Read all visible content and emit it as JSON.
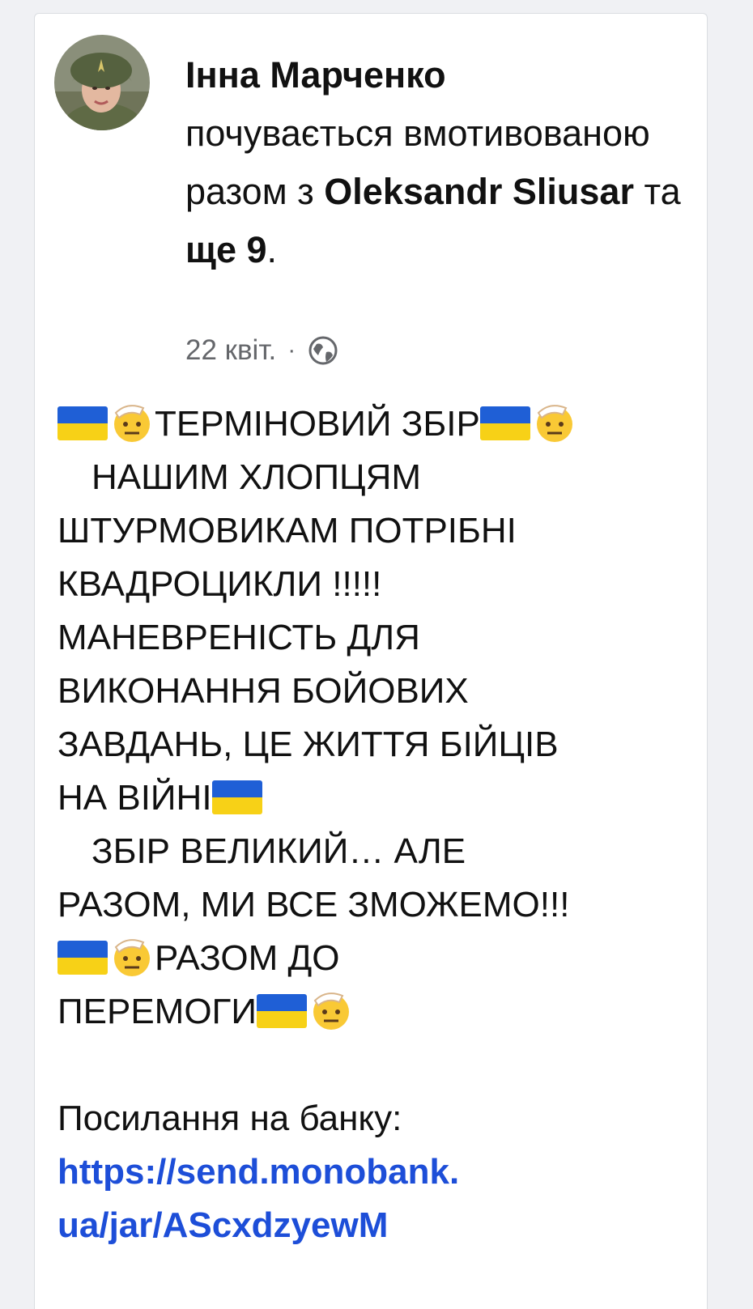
{
  "post": {
    "author": "Інна Марченко",
    "feeling": "почувається вмотивованою разом з",
    "tagged": "Oleksandr Sliusar",
    "and_word": "та",
    "others": "ще 9",
    "period": ".",
    "date": "22 квіт.",
    "separator": "·",
    "audience_icon": "globe-icon"
  },
  "body": {
    "l1": "ТЕРМІНОВИЙ ЗБІР",
    "l2": "НАШИМ ХЛОПЦЯМ",
    "l3": "ШТУРМОВИКАМ ПОТРІБНІ",
    "l4": "КВАДРОЦИКЛИ !!!!!",
    "l5": "МАНЕВРЕНІСТЬ ДЛЯ",
    "l6": "ВИКОНАННЯ БОЙОВИХ",
    "l7": "ЗАВДАНЬ, ЦЕ ЖИТТЯ БІЙЦІВ",
    "l8": "НА ВІЙНІ",
    "l9": "ЗБІР ВЕЛИКИЙ… АЛЕ",
    "l10": "РАЗОМ, МИ ВСЕ ЗМОЖЕМО!!!",
    "l11": "РАЗОМ ДО",
    "l12": "ПЕРЕМОГИ",
    "bank_label": "Посилання на банку:",
    "link_line1": "https://send.monobank.",
    "link_line2": "ua/jar/AScxdzyewM"
  },
  "emoji": {
    "flag": "ukraine-flag-emoji",
    "salute": "saluting-face-emoji"
  },
  "colors": {
    "link": "#1d4ed8",
    "meta": "#65676b",
    "flag_blue": "#1f5fd6",
    "flag_yellow": "#f7d117"
  }
}
